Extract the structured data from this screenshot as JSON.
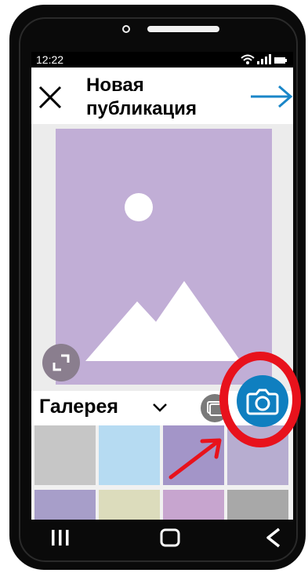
{
  "status_bar": {
    "time": "12:22",
    "icons": [
      "wifi-icon",
      "signal-icon",
      "battery-icon"
    ]
  },
  "header": {
    "close_icon": "close-icon",
    "title": "Новая публикация",
    "next_icon": "arrow-right-icon"
  },
  "preview": {
    "placeholder_icon": "image-placeholder-icon",
    "expand_icon": "expand-icon"
  },
  "gallery": {
    "label": "Галерея",
    "dropdown_icon": "chevron-down-icon",
    "multi_select_icon": "multi-select-icon",
    "camera_icon": "camera-icon",
    "thumbnails": [
      {
        "color": "#c6c6c6"
      },
      {
        "color": "#b6dbf2"
      },
      {
        "color": "#a395c8"
      },
      {
        "color": "#b7add0"
      },
      {
        "color": "#a79ec9"
      },
      {
        "color": "#dcdcbc"
      },
      {
        "color": "#c7a5cf"
      },
      {
        "color": "#a8a8a8"
      }
    ]
  },
  "annotation": {
    "highlight_color": "#e8121c",
    "hint_arrow_icon": "arrow-pointer-icon"
  },
  "nav_bar": {
    "icons": [
      "recent-apps-icon",
      "home-icon",
      "back-icon"
    ]
  },
  "colors": {
    "accent": "#0f7fc0",
    "image_placeholder": "#c1aed6"
  }
}
